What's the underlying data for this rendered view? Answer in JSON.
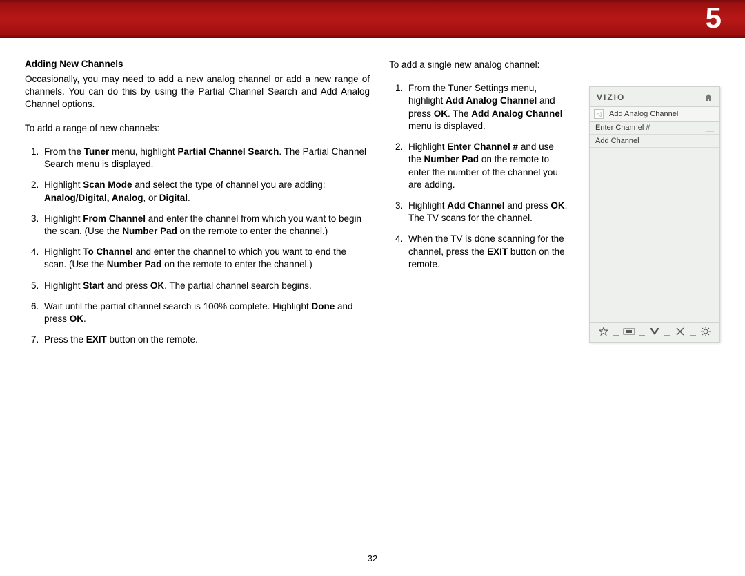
{
  "chapter": "5",
  "pageNumber": "32",
  "left": {
    "heading": "Adding New Channels",
    "intro": "Occasionally, you may need to add a new analog channel or add a new range of channels. You can do this by using the Partial Channel Search and Add Analog Channel options.",
    "subIntro": "To add a range of new channels:",
    "s1a": "From the ",
    "s1b": "Tuner",
    "s1c": " menu, highlight ",
    "s1d": "Partial Channel Search",
    "s1e": ". The Partial Channel Search menu is displayed.",
    "s2a": "Highlight ",
    "s2b": "Scan Mode",
    "s2c": " and select the type of channel you are adding: ",
    "s2d": "Analog/Digital, Analog",
    "s2e": ", or ",
    "s2f": "Digital",
    "s2g": ".",
    "s3a": "Highlight ",
    "s3b": "From Channel",
    "s3c": " and enter the channel from which you want to begin the scan. (Use the ",
    "s3d": "Number Pad",
    "s3e": " on the remote to enter the channel.)",
    "s4a": "Highlight ",
    "s4b": "To Channel",
    "s4c": " and enter the channel to which you want to end the scan. (Use the ",
    "s4d": "Number Pad",
    "s4e": " on the remote to enter the channel.)",
    "s5a": "Highlight ",
    "s5b": "Start",
    "s5c": " and press ",
    "s5d": "OK",
    "s5e": ". The partial channel search begins.",
    "s6a": "Wait until the partial channel search is 100% complete. Highlight ",
    "s6b": "Done",
    "s6c": " and press ",
    "s6d": "OK",
    "s6e": ".",
    "s7a": "Press the ",
    "s7b": "EXIT",
    "s7c": " button on the remote."
  },
  "right": {
    "intro": "To add a single new analog channel:",
    "s1a": "From the Tuner Settings menu, highlight ",
    "s1b": "Add Analog Channel",
    "s1c": " and press ",
    "s1d": "OK",
    "s1e": ". The ",
    "s1f": "Add Analog Channel",
    "s1g": " menu is displayed.",
    "s2a": "Highlight ",
    "s2b": "Enter Channel #",
    "s2c": " and use the ",
    "s2d": "Number Pad",
    "s2e": " on the remote to enter the number of the channel you are adding.",
    "s3a": "Highlight ",
    "s3b": "Add Channel",
    "s3c": " and press ",
    "s3d": "OK",
    "s3e": ". The TV scans for the channel.",
    "s4a": "When the TV is done scanning for the channel, press the ",
    "s4b": "EXIT",
    "s4c": " button on the remote."
  },
  "osd": {
    "logo": "VIZIO",
    "title": "Add Analog Channel",
    "row1Label": "Enter Channel #",
    "row1Value": "__",
    "row2Label": "Add Channel"
  }
}
